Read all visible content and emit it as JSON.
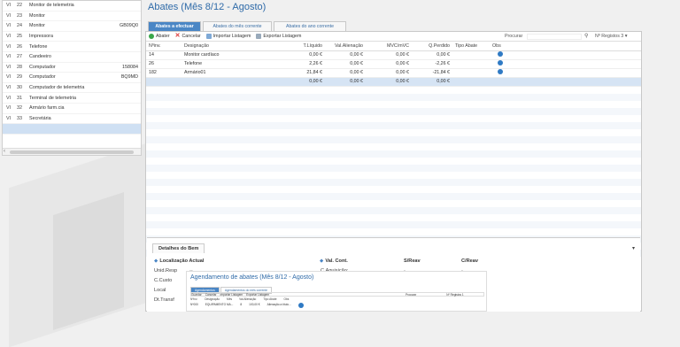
{
  "sidebar": {
    "rows": [
      {
        "c1": "VI",
        "c2": "22",
        "name": "Monitor de telemetria",
        "code": ""
      },
      {
        "c1": "VI",
        "c2": "23",
        "name": "Monitor",
        "code": ""
      },
      {
        "c1": "VI",
        "c2": "24",
        "name": "Monitor",
        "code": "GB09Q0"
      },
      {
        "c1": "VI",
        "c2": "25",
        "name": "Impressora",
        "code": ""
      },
      {
        "c1": "VI",
        "c2": "26",
        "name": "Telefone",
        "code": ""
      },
      {
        "c1": "VI",
        "c2": "27",
        "name": "Candeeiro",
        "code": ""
      },
      {
        "c1": "VI",
        "c2": "28",
        "name": "Computador",
        "code": "158084"
      },
      {
        "c1": "VI",
        "c2": "29",
        "name": "Computador",
        "code": "BQ9MD"
      },
      {
        "c1": "VI",
        "c2": "30",
        "name": "Computador de telemetria",
        "code": ""
      },
      {
        "c1": "VI",
        "c2": "31",
        "name": "Terminal de telemetria",
        "code": ""
      },
      {
        "c1": "VI",
        "c2": "32",
        "name": "Armário farm.cia",
        "code": ""
      },
      {
        "c1": "VI",
        "c2": "33",
        "name": "Secretária",
        "code": ""
      }
    ]
  },
  "page_title": "Abates (Mês 8/12 - Agosto)",
  "tabs": [
    {
      "label": "Abates a efectuar",
      "active": true
    },
    {
      "label": "Abates do mês corrente",
      "active": false
    },
    {
      "label": "Abates do ano corrente",
      "active": false
    }
  ],
  "toolbar": {
    "abater": "Abater",
    "cancelar": "Cancelar",
    "importar": "Importar Listagem",
    "exportar": "Exportar Listagem",
    "search_label": "Procurar",
    "reg_count": "Nº Registos 3"
  },
  "table": {
    "headers": [
      "Nºinv.",
      "Designação",
      "T.Líquido",
      "Val.Alienação",
      "MVC/mVC",
      "Q.Perdido",
      "Tipo Abate",
      "Obs"
    ],
    "rows": [
      [
        "14",
        "Monitor cardíaco",
        "0,00 €",
        "0,00 €",
        "0,00 €",
        "0,00 €"
      ],
      [
        "26",
        "Telefone",
        "2,26 €",
        "0,00 €",
        "0,00 €",
        "-2,26 €"
      ],
      [
        "182",
        "Armário01",
        "21,84 €",
        "0,00 €",
        "0,00 €",
        "-21,84 €"
      ]
    ],
    "totals": [
      "0,00 €",
      "0,00 €",
      "0,00 €",
      "0,00 €"
    ]
  },
  "detail": {
    "tab": "Detalhes do Bem",
    "loc_title": "Localização Actual",
    "val_title": "Val. Cont.",
    "s_reav": "S/Reav",
    "c_reav": "C/Reav",
    "labels": [
      "Unid.Resp",
      "C.Custo",
      "Local",
      "Dt.Transf"
    ],
    "aquisicao": "C.Aquisição:",
    "dash": "--",
    "dash_right": "-"
  },
  "thumb": {
    "title": "Agendamento de abates (Mês 8/12 - Agosto)",
    "tabs": [
      "Agendamentos",
      "Agendamentos do mês corrente"
    ],
    "bar": [
      "Guardar",
      "Cancelar",
      "Importar Listagem",
      "Exportar Listagem"
    ],
    "search": "Procurar",
    "count": "Nº Registos 1",
    "head": [
      "Nºinv.",
      "Designação",
      "Mês",
      "Val.Alienação",
      "Tipo Abate",
      "Obs"
    ],
    "row": [
      "Nº000",
      "EQUIPAMENTO MA...",
      "8",
      "100,00 €",
      "Alienação a título..."
    ]
  }
}
